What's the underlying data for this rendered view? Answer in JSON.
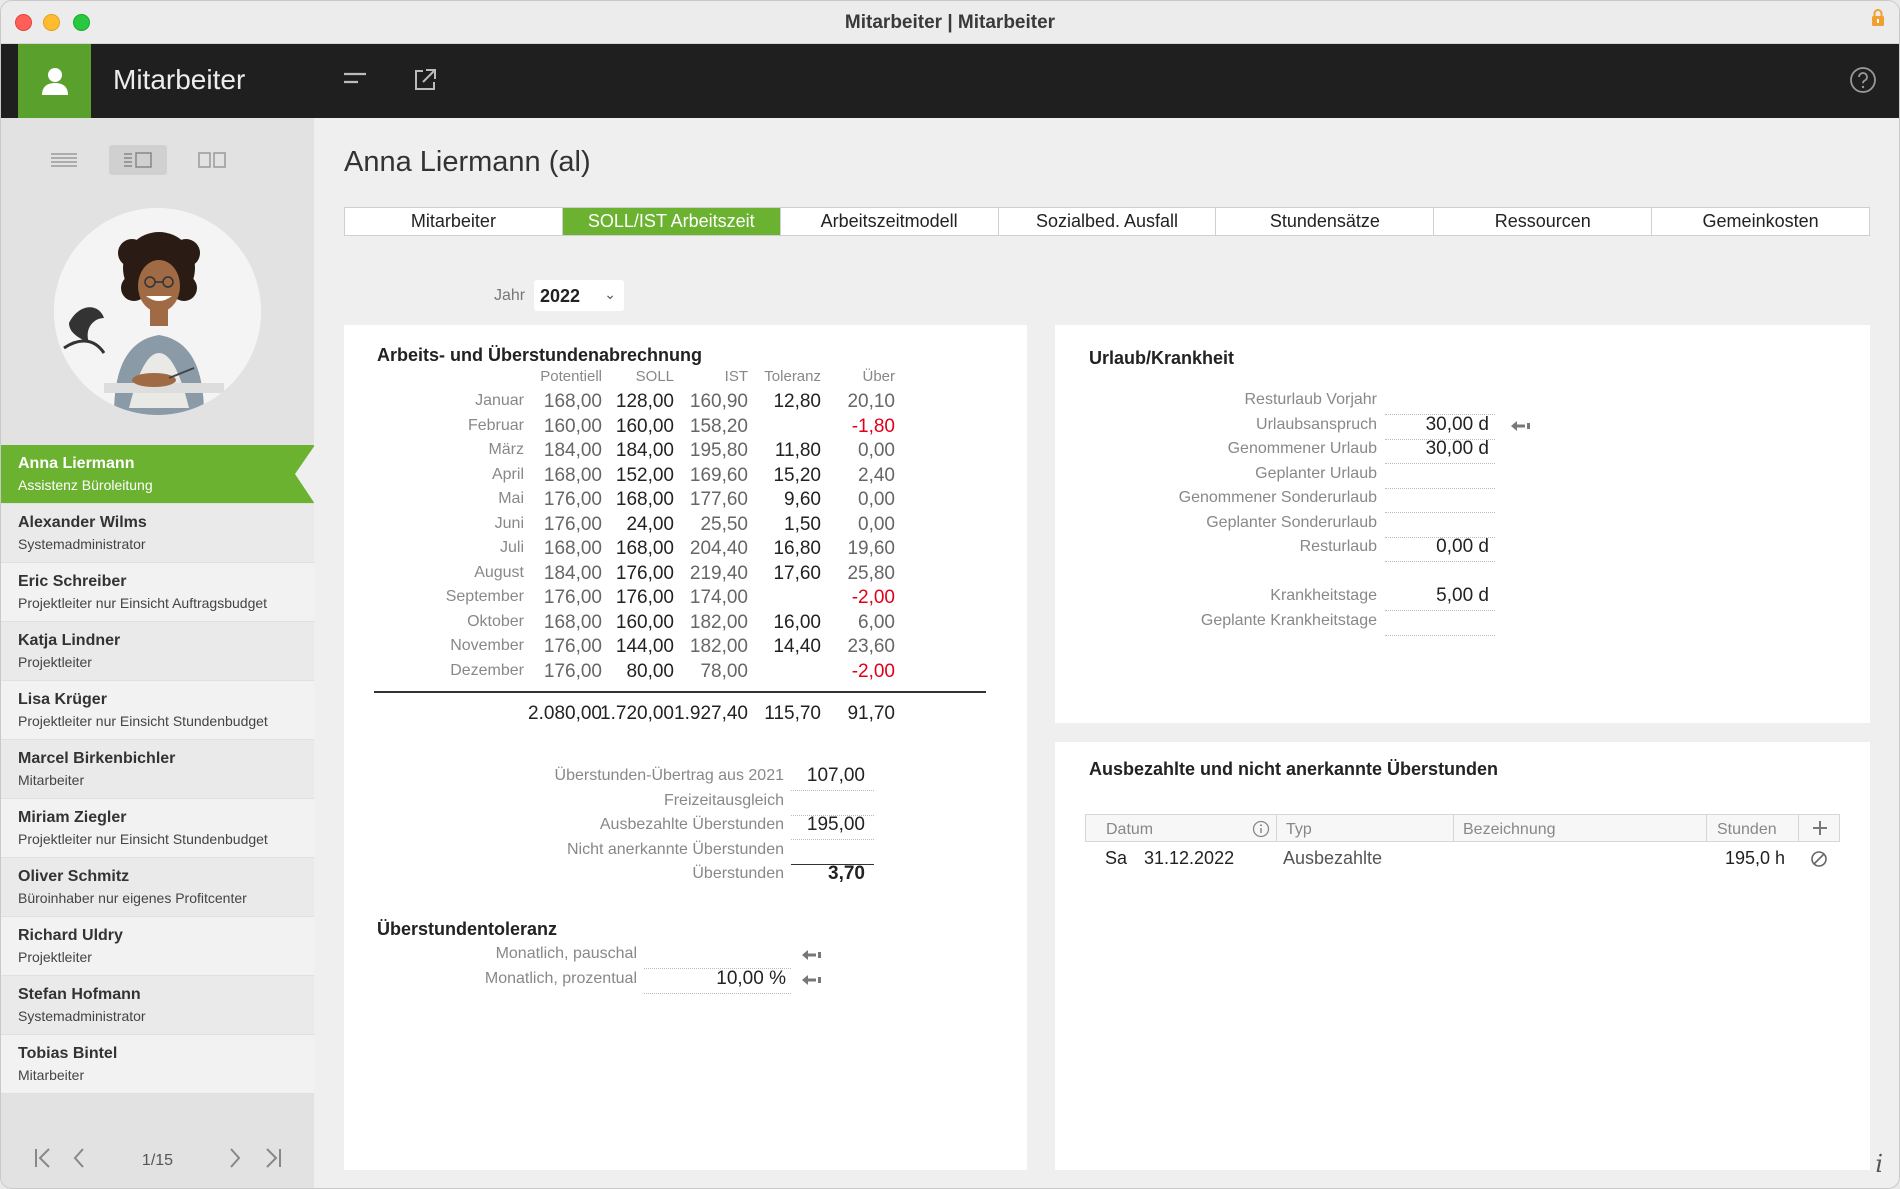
{
  "window": {
    "title": "Mitarbeiter | Mitarbeiter"
  },
  "header": {
    "app_name": "Mitarbeiter"
  },
  "employee": {
    "title": "Anna Liermann (al)"
  },
  "tabs": [
    "Mitarbeiter",
    "SOLL/IST Arbeitszeit",
    "Arbeitszeitmodell",
    "Sozialbed. Ausfall",
    "Stundensätze",
    "Ressourcen",
    "Gemeinkosten"
  ],
  "active_tab_index": 1,
  "year": {
    "label": "Jahr",
    "value": "2022"
  },
  "people": [
    {
      "name": "Anna Liermann",
      "role": "Assistenz Büroleitung",
      "active": true
    },
    {
      "name": "Alexander Wilms",
      "role": "Systemadministrator"
    },
    {
      "name": "Eric Schreiber",
      "role": "Projektleiter nur Einsicht Auftragsbudget"
    },
    {
      "name": "Katja Lindner",
      "role": "Projektleiter"
    },
    {
      "name": "Lisa Krüger",
      "role": "Projektleiter nur Einsicht Stundenbudget"
    },
    {
      "name": "Marcel Birkenbichler",
      "role": "Mitarbeiter"
    },
    {
      "name": "Miriam Ziegler",
      "role": "Projektleiter nur Einsicht Stundenbudget"
    },
    {
      "name": "Oliver Schmitz",
      "role": "Büroinhaber nur eigenes Profitcenter"
    },
    {
      "name": "Richard Uldry",
      "role": "Projektleiter"
    },
    {
      "name": "Stefan Hofmann",
      "role": "Systemadministrator"
    },
    {
      "name": "Tobias Bintel",
      "role": "Mitarbeiter"
    }
  ],
  "pager": {
    "text": "1/15"
  },
  "overtime": {
    "title": "Arbeits- und Überstundenabrechnung",
    "columns": [
      "Potentiell",
      "SOLL",
      "IST",
      "Toleranz",
      "Über"
    ],
    "rows": [
      {
        "month": "Januar",
        "pot": "168,00",
        "soll": "128,00",
        "ist": "160,90",
        "tol": "12,80",
        "ueber": "20,10",
        "neg": false
      },
      {
        "month": "Februar",
        "pot": "160,00",
        "soll": "160,00",
        "ist": "158,20",
        "tol": "",
        "ueber": "-1,80",
        "neg": true
      },
      {
        "month": "März",
        "pot": "184,00",
        "soll": "184,00",
        "ist": "195,80",
        "tol": "11,80",
        "ueber": "0,00",
        "neg": false
      },
      {
        "month": "April",
        "pot": "168,00",
        "soll": "152,00",
        "ist": "169,60",
        "tol": "15,20",
        "ueber": "2,40",
        "neg": false
      },
      {
        "month": "Mai",
        "pot": "176,00",
        "soll": "168,00",
        "ist": "177,60",
        "tol": "9,60",
        "ueber": "0,00",
        "neg": false
      },
      {
        "month": "Juni",
        "pot": "176,00",
        "soll": "24,00",
        "ist": "25,50",
        "tol": "1,50",
        "ueber": "0,00",
        "neg": false
      },
      {
        "month": "Juli",
        "pot": "168,00",
        "soll": "168,00",
        "ist": "204,40",
        "tol": "16,80",
        "ueber": "19,60",
        "neg": false
      },
      {
        "month": "August",
        "pot": "184,00",
        "soll": "176,00",
        "ist": "219,40",
        "tol": "17,60",
        "ueber": "25,80",
        "neg": false
      },
      {
        "month": "September",
        "pot": "176,00",
        "soll": "176,00",
        "ist": "174,00",
        "tol": "",
        "ueber": "-2,00",
        "neg": true
      },
      {
        "month": "Oktober",
        "pot": "168,00",
        "soll": "160,00",
        "ist": "182,00",
        "tol": "16,00",
        "ueber": "6,00",
        "neg": false
      },
      {
        "month": "November",
        "pot": "176,00",
        "soll": "144,00",
        "ist": "182,00",
        "tol": "14,40",
        "ueber": "23,60",
        "neg": false
      },
      {
        "month": "Dezember",
        "pot": "176,00",
        "soll": "80,00",
        "ist": "78,00",
        "tol": "",
        "ueber": "-2,00",
        "neg": true
      }
    ],
    "totals": {
      "pot": "2.080,00",
      "soll": "1.720,00",
      "ist": "1.927,40",
      "tol": "115,70",
      "ueber": "91,70"
    },
    "summary": [
      {
        "label": "Überstunden-Übertrag aus 2021",
        "value": "107,00"
      },
      {
        "label": "Freizeitausgleich",
        "value": ""
      },
      {
        "label": "Ausbezahlte Überstunden",
        "value": "195,00"
      },
      {
        "label": "Nicht anerkannte Überstunden",
        "value": ""
      },
      {
        "label": "Überstunden",
        "value": "3,70"
      }
    ]
  },
  "tolerance": {
    "title": "Überstundentoleranz",
    "rows": [
      {
        "label": "Monatlich, pauschal",
        "value": ""
      },
      {
        "label": "Monatlich, prozentual",
        "value": "10,00 %"
      }
    ]
  },
  "vacation": {
    "title": "Urlaub/Krankheit",
    "rows": [
      {
        "label": "Resturlaub Vorjahr",
        "value": ""
      },
      {
        "label": "Urlaubsanspruch",
        "value": "30,00 d"
      },
      {
        "label": "Genommener Urlaub",
        "value": "30,00 d"
      },
      {
        "label": "Geplanter Urlaub",
        "value": ""
      },
      {
        "label": "Genommener Sonderurlaub",
        "value": ""
      },
      {
        "label": "Geplanter Sonderurlaub",
        "value": ""
      },
      {
        "label": "Resturlaub",
        "value": "0,00 d"
      },
      {
        "label": "Krankheitstage",
        "value": "5,00 d"
      },
      {
        "label": "Geplante Krankheitstage",
        "value": ""
      }
    ]
  },
  "payout": {
    "title": "Ausbezahlte und nicht anerkannte Überstunden",
    "columns": [
      "Datum",
      "Typ",
      "Bezeichnung",
      "Stunden"
    ],
    "rows": [
      {
        "weekday": "Sa",
        "date": "31.12.2022",
        "type": "Ausbezahlte",
        "desc": "",
        "hours": "195,0 h"
      }
    ]
  },
  "colors": {
    "accent": "#6ab230",
    "negative": "#e0001a",
    "header_bg": "#1f1f1f"
  },
  "icons": [
    "user-icon",
    "menu-icon",
    "export-icon",
    "help-icon",
    "list-view-icon",
    "split-view-icon",
    "card-view-icon",
    "first-page-icon",
    "prev-page-icon",
    "next-page-icon",
    "last-page-icon",
    "arrow-left-icon",
    "info-icon",
    "add-icon",
    "cancel-icon",
    "lock-icon"
  ]
}
